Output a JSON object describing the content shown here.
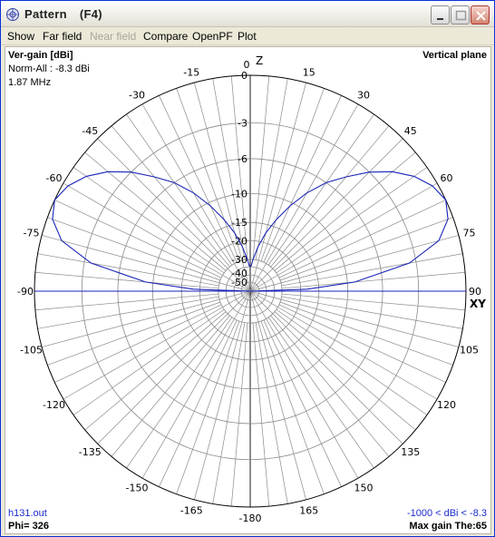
{
  "window": {
    "title": "Pattern",
    "shortcut": "(F4)"
  },
  "menu": [
    "Show",
    "Far field",
    "Near field",
    "Compare",
    "OpenPF",
    "Plot"
  ],
  "menu_disabled": [
    "Near field"
  ],
  "info": {
    "gain_label": "Ver-gain [dBi]",
    "norm": "Norm-All : -8.3 dBi",
    "freq": "1.87 MHz",
    "plane": "Vertical plane",
    "file": "h131.out",
    "phi": "Phi= 326",
    "range": "-1000 < dBi < -8.3",
    "max_gain": "Max gain The:65"
  },
  "axis_labels": {
    "top": "Z",
    "right": "XY"
  },
  "colors": {
    "pattern": "#1a23b8",
    "grid": "#8a8a8a",
    "info_blue": "#1a2bcc"
  },
  "chart_data": {
    "type": "polar",
    "angle_unit": "deg",
    "angle_ticks": [
      0,
      15,
      30,
      45,
      60,
      75,
      90,
      105,
      120,
      135,
      150,
      165,
      -180,
      -165,
      -150,
      -135,
      -120,
      -105,
      -90,
      -75,
      -60,
      -45,
      -30,
      -15
    ],
    "ring_labels": [
      "0",
      "-3",
      "-6",
      "-10",
      "-15",
      "-20",
      "-30",
      "-40",
      "-50"
    ],
    "series": [
      {
        "theta": [
          0,
          2,
          5,
          10,
          15,
          20,
          25,
          30,
          35,
          40,
          45,
          50,
          55,
          60,
          65,
          70,
          75,
          80,
          85,
          88,
          90
        ],
        "gain_db": [
          -40,
          -38,
          -30,
          -22,
          -17,
          -13.5,
          -10.5,
          -8,
          -6,
          -4.5,
          -3,
          -1.8,
          -0.9,
          -0.3,
          0,
          -0.3,
          -1.2,
          -3.5,
          -9,
          -18,
          -50
        ]
      }
    ]
  }
}
